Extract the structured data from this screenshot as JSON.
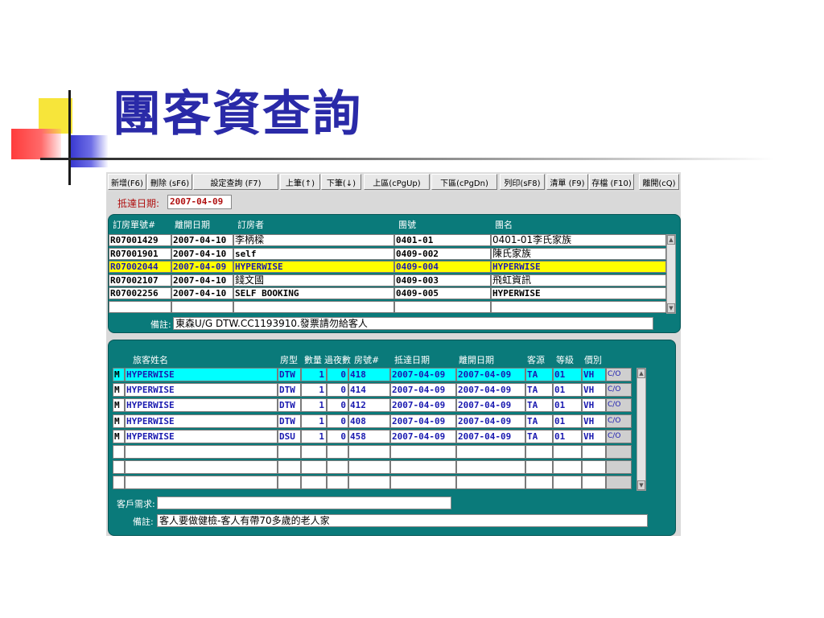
{
  "slide_title": "團客資查詢",
  "toolbar": [
    {
      "id": "new",
      "label": "新增(F6)"
    },
    {
      "id": "delete",
      "label": "刪除 (sF6)"
    },
    {
      "id": "set-query",
      "label": "設定查詢 (F7)"
    },
    {
      "id": "prev",
      "label": "上筆(↑)"
    },
    {
      "id": "next",
      "label": "下筆(↓)"
    },
    {
      "id": "page-up",
      "label": "上區(cPgUp)"
    },
    {
      "id": "page-down",
      "label": "下區(cPgDn)"
    },
    {
      "id": "print",
      "label": "列印(sF8)"
    },
    {
      "id": "clear",
      "label": "清單 (F9)"
    },
    {
      "id": "save",
      "label": "存檔 (F10)"
    },
    {
      "id": "exit",
      "label": "離開(cQ)"
    }
  ],
  "arrival": {
    "label": "抵達日期:",
    "value": "2007-04-09"
  },
  "booking_table": {
    "headers": [
      "訂房單號#",
      "離開日期",
      "訂房者",
      "團號",
      "團名"
    ],
    "rows": [
      {
        "no": "R07001429",
        "depart": "2007-04-10",
        "booker": "李柄樑",
        "group_no": "0401-01",
        "group_name": "0401-01李氏家族"
      },
      {
        "no": "R07001901",
        "depart": "2007-04-10",
        "booker": "self",
        "group_no": "0409-002",
        "group_name": "陳氏家族"
      },
      {
        "no": "R07002044",
        "depart": "2007-04-09",
        "booker": "HYPERWISE",
        "group_no": "0409-004",
        "group_name": "HYPERWISE"
      },
      {
        "no": "R07002107",
        "depart": "2007-04-10",
        "booker": "錢文國",
        "group_no": "0409-003",
        "group_name": "飛虹資訊"
      },
      {
        "no": "R07002256",
        "depart": "2007-04-10",
        "booker": "SELF BOOKING",
        "group_no": "0409-005",
        "group_name": "HYPERWISE"
      }
    ],
    "remark_label": "備註:",
    "remark": "東森U/G DTW.CC1193910.發票請勿給客人"
  },
  "guest_table": {
    "headers": [
      "旅客姓名",
      "房型",
      "數量",
      "過夜數",
      "房號#",
      "抵達日期",
      "離開日期",
      "客源",
      "等級",
      "價別"
    ],
    "rows": [
      {
        "flag": "M",
        "name": "HYPERWISE",
        "room_type": "DTW",
        "qty": "1",
        "nights": "0",
        "room": "418",
        "arrive": "2007-04-09",
        "depart": "2007-04-09",
        "source": "TA",
        "grade": "01",
        "rate": "VH",
        "status": "C/O"
      },
      {
        "flag": "M",
        "name": "HYPERWISE",
        "room_type": "DTW",
        "qty": "1",
        "nights": "0",
        "room": "414",
        "arrive": "2007-04-09",
        "depart": "2007-04-09",
        "source": "TA",
        "grade": "01",
        "rate": "VH",
        "status": "C/O"
      },
      {
        "flag": "M",
        "name": "HYPERWISE",
        "room_type": "DTW",
        "qty": "1",
        "nights": "0",
        "room": "412",
        "arrive": "2007-04-09",
        "depart": "2007-04-09",
        "source": "TA",
        "grade": "01",
        "rate": "VH",
        "status": "C/O"
      },
      {
        "flag": "M",
        "name": "HYPERWISE",
        "room_type": "DTW",
        "qty": "1",
        "nights": "0",
        "room": "408",
        "arrive": "2007-04-09",
        "depart": "2007-04-09",
        "source": "TA",
        "grade": "01",
        "rate": "VH",
        "status": "C/O"
      },
      {
        "flag": "M",
        "name": "HYPERWISE",
        "room_type": "DSU",
        "qty": "1",
        "nights": "0",
        "room": "458",
        "arrive": "2007-04-09",
        "depart": "2007-04-09",
        "source": "TA",
        "grade": "01",
        "rate": "VH",
        "status": "C/O"
      }
    ],
    "request_label": "客戶需求:",
    "request": "",
    "remark_label": "備註:",
    "remark": "客人要做健檢-客人有帶70多歲的老人家"
  }
}
